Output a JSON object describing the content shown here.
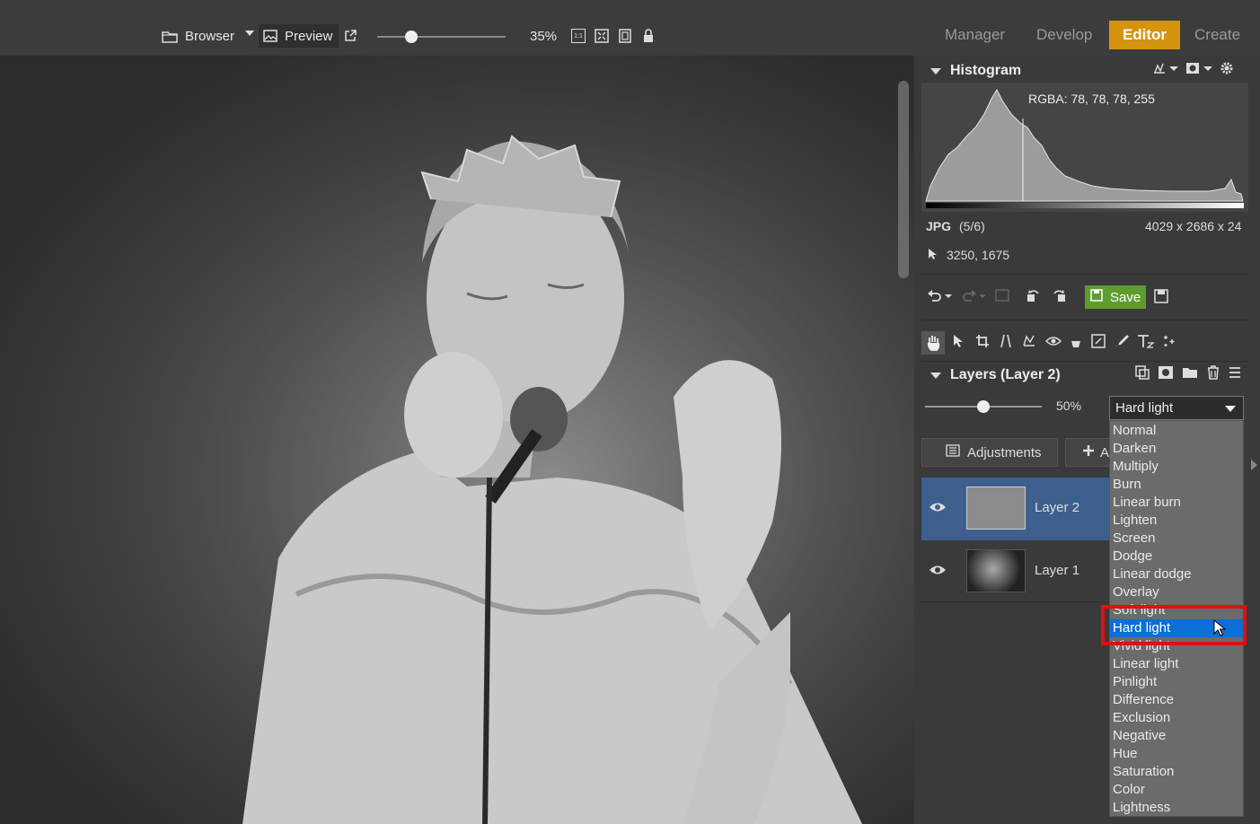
{
  "toolbar": {
    "browser_label": "Browser",
    "preview_label": "Preview",
    "zoom": "35%",
    "zoom_level": 0.35,
    "zoom_icons": [
      "1:1",
      "fit-icon",
      "fill-icon",
      "lock-icon"
    ]
  },
  "modes": {
    "manager": "Manager",
    "develop": "Develop",
    "editor": "Editor",
    "create": "Create",
    "active_color": "#d4940e"
  },
  "histogram": {
    "title": "Histogram",
    "rgba": "RGBA:  78,  78,  78, 255",
    "format": "JPG",
    "index": "(5/6)",
    "dims": "4029 x 2686 x 24",
    "coords": "3250, 1675"
  },
  "actions": {
    "save_label": "Save",
    "save_color": "#5f9c2e"
  },
  "layers": {
    "title": "Layers (Layer 2)",
    "opacity": "50%",
    "opacity_value": 0.5,
    "blend_mode": "Hard light",
    "adjustments_label": "Adjustments",
    "add_label": "A",
    "items": [
      {
        "name": "Layer 2",
        "selected": true
      },
      {
        "name": "Layer 1",
        "selected": false
      }
    ],
    "selected_color": "#3d5f8e"
  },
  "blend_options": [
    "Normal",
    "Darken",
    "Multiply",
    "Burn",
    "Linear burn",
    "Lighten",
    "Screen",
    "Dodge",
    "Linear dodge",
    "Overlay",
    "Soft light",
    "Hard light",
    "Vivid light",
    "Linear light",
    "Pinlight",
    "Difference",
    "Exclusion",
    "Negative",
    "Hue",
    "Saturation",
    "Color",
    "Lightness"
  ],
  "dropdown": {
    "selected_color": "#0a6fd6",
    "highlight_color": "#e01010"
  }
}
